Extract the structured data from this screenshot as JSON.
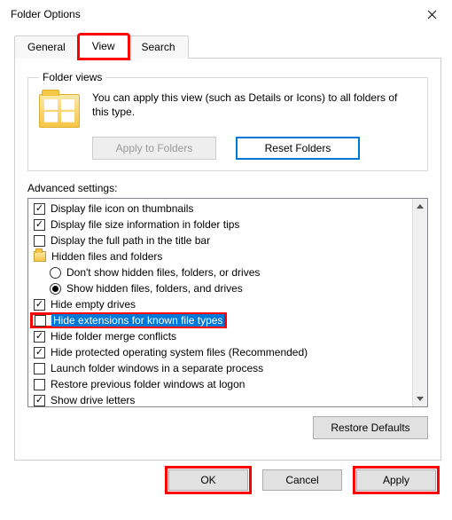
{
  "window": {
    "title": "Folder Options"
  },
  "tabs": {
    "general": "General",
    "view": "View",
    "search": "Search",
    "active": "View"
  },
  "folderViews": {
    "legend": "Folder views",
    "text": "You can apply this view (such as Details or Icons) to all folders of this type.",
    "applyBtn": "Apply to Folders",
    "resetBtn": "Reset Folders"
  },
  "advanced": {
    "label": "Advanced settings:",
    "items": [
      {
        "kind": "check",
        "checked": true,
        "indent": 0,
        "label": "Display file icon on thumbnails"
      },
      {
        "kind": "check",
        "checked": true,
        "indent": 0,
        "label": "Display file size information in folder tips"
      },
      {
        "kind": "check",
        "checked": false,
        "indent": 0,
        "label": "Display the full path in the title bar"
      },
      {
        "kind": "group",
        "indent": 0,
        "label": "Hidden files and folders"
      },
      {
        "kind": "radio",
        "checked": false,
        "indent": 1,
        "label": "Don't show hidden files, folders, or drives"
      },
      {
        "kind": "radio",
        "checked": true,
        "indent": 1,
        "label": "Show hidden files, folders, and drives"
      },
      {
        "kind": "check",
        "checked": true,
        "indent": 0,
        "label": "Hide empty drives"
      },
      {
        "kind": "check",
        "checked": false,
        "indent": 0,
        "label": "Hide extensions for known file types",
        "highlighted": true
      },
      {
        "kind": "check",
        "checked": true,
        "indent": 0,
        "label": "Hide folder merge conflicts"
      },
      {
        "kind": "check",
        "checked": true,
        "indent": 0,
        "label": "Hide protected operating system files (Recommended)"
      },
      {
        "kind": "check",
        "checked": false,
        "indent": 0,
        "label": "Launch folder windows in a separate process"
      },
      {
        "kind": "check",
        "checked": false,
        "indent": 0,
        "label": "Restore previous folder windows at logon"
      },
      {
        "kind": "check",
        "checked": true,
        "indent": 0,
        "label": "Show drive letters"
      }
    ],
    "restoreDefaults": "Restore Defaults"
  },
  "buttons": {
    "ok": "OK",
    "cancel": "Cancel",
    "apply": "Apply"
  }
}
